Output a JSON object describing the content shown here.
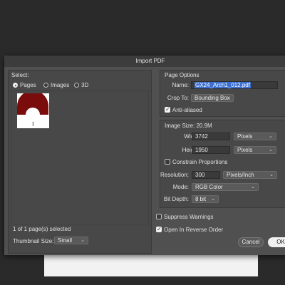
{
  "dialog": {
    "title": "Import PDF"
  },
  "select": {
    "heading": "Select:",
    "options": [
      "Pages",
      "Images",
      "3D"
    ],
    "selected": "Pages",
    "thumbnail_page": "1",
    "selection_status": "1 of 1 page(s) selected",
    "thumbnail_size_label": "Thumbnail Size:",
    "thumbnail_size_value": "Small"
  },
  "page_options": {
    "heading": "Page Options",
    "name_label": "Name:",
    "name_value": "GX24_Arch1_012.pdf",
    "crop_label": "Crop To:",
    "crop_value": "Bounding Box",
    "anti_aliased_label": "Anti-aliased",
    "anti_aliased": true
  },
  "image_size": {
    "heading": "Image Size: 20.9M",
    "width_label": "Width:",
    "width_value": "3742",
    "width_unit": "Pixels",
    "height_label": "Height:",
    "height_value": "1950",
    "height_unit": "Pixels",
    "constrain_label": "Constrain Proportions",
    "constrain": false,
    "resolution_label": "Resolution:",
    "resolution_value": "300",
    "resolution_unit": "Pixels/Inch",
    "mode_label": "Mode:",
    "mode_value": "RGB Color",
    "bitdepth_label": "Bit Depth:",
    "bitdepth_value": "8 bit"
  },
  "options": {
    "suppress_label": "Suppress Warnings",
    "suppress": false,
    "reverse_label": "Open In Reverse Order",
    "reverse": true
  },
  "buttons": {
    "cancel": "Cancel",
    "ok": "OK"
  },
  "colors": {
    "thumb_shape": "#7a0c0c",
    "highlight": "#3b6fd1"
  },
  "icons": {
    "dropdown": "chevron-down-icon",
    "check": "checkmark-icon"
  }
}
